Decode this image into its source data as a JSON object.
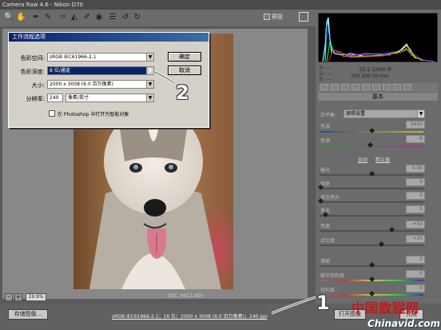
{
  "window": {
    "title": "Camera Raw 4.6 - Nikon D70"
  },
  "toolbar": {
    "tools": [
      "zoom-icon",
      "hand-icon",
      "white-balance-icon",
      "color-sampler-icon",
      "crop-icon",
      "straighten-icon",
      "retouch-icon",
      "red-eye-icon",
      "preferences-icon",
      "rotate-left-icon",
      "rotate-right-icon"
    ],
    "preview_label": "预览"
  },
  "histogram": {
    "colors": [
      "#ff2020",
      "#20ff20",
      "#3050ff",
      "#ffff30",
      "#ff40ff",
      "#30ffff",
      "#ffffff"
    ]
  },
  "camera_info": {
    "r": "R: ---",
    "g": "G: ---",
    "b": "B: ---",
    "aperture_shutter": "f/2.2  1/600 秒",
    "iso_focal": "ISO 200  50 mm"
  },
  "panel": {
    "section_title": "基本",
    "white_balance_label": "白平衡:",
    "white_balance_value": "原照设置",
    "temperature_label": "色温",
    "temperature_value": "5450",
    "tint_label": "色调",
    "tint_value": "-9",
    "auto_link": "自动",
    "default_link": "默认值",
    "exposure_label": "曝光",
    "exposure_value": "0.00",
    "recovery_label": "恢复",
    "recovery_value": "0",
    "fill_light_label": "填充亮光",
    "fill_light_value": "0",
    "blacks_label": "黑色",
    "blacks_value": "5",
    "brightness_label": "亮度",
    "brightness_value": "+50",
    "contrast_label": "对比度",
    "contrast_value": "+25",
    "clarity_label": "清晰",
    "clarity_value": "0",
    "vibrance_label": "细节饱和度",
    "vibrance_value": "0",
    "saturation_label": "饱和度",
    "saturation_value": "0"
  },
  "canvas": {
    "zoom_minus": "-",
    "zoom_plus": "+",
    "zoom_value": "19.9%",
    "filename": "DSC_4912.NEF"
  },
  "bottom": {
    "save_label": "存储图像...",
    "workflow_link": "sRGB IEC61966-2.1；16 位；2000 x 3008 (6.0 百万像素)；240 ppi",
    "open_label": "打开图像",
    "done_label": "完成"
  },
  "dialog": {
    "title": "工作流程选项",
    "space_label": "色彩空间:",
    "space_value": "sRGB IEC61966-2.1",
    "depth_label": "色彩深度:",
    "depth_value": "8 位/通道",
    "size_label": "大小:",
    "size_value": "2000 x 3008  (6.0 百万像素)",
    "resolution_label": "分辨率:",
    "resolution_value": "240",
    "resolution_unit": "像素/英寸",
    "ok_label": "确定",
    "cancel_label": "取消",
    "smart_label": "在 Photoshop 中打开为智能对象"
  },
  "annotations": {
    "step1": "1",
    "step2": "2"
  },
  "watermark": {
    "site_cn": "中国教程网",
    "url": "www.jcwcn.com",
    "brand": "Chinavid.com"
  }
}
